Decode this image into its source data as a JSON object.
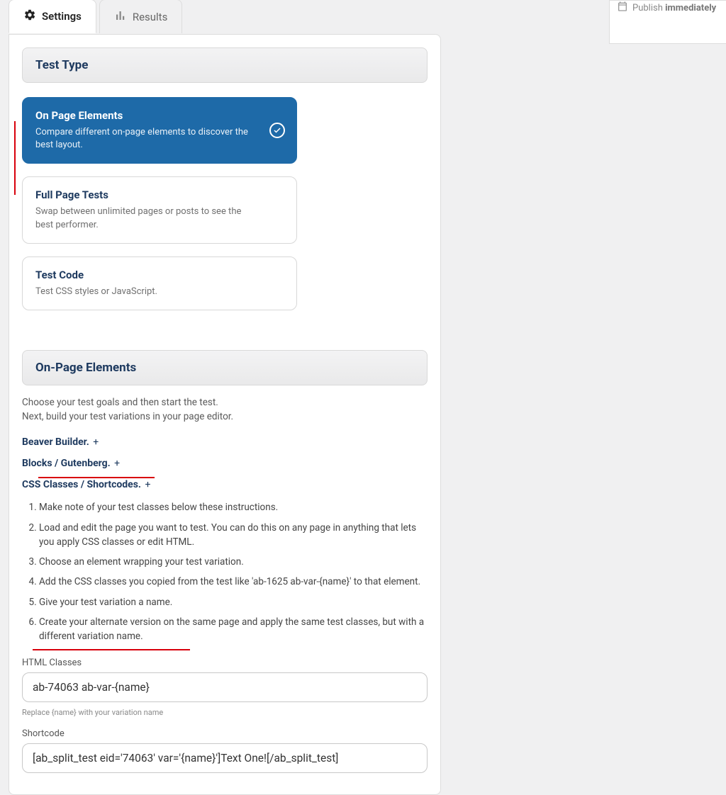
{
  "sidebar": {
    "publish_prefix": "Publish ",
    "publish_bold": "immediately"
  },
  "tabs": {
    "settings": "Settings",
    "results": "Results"
  },
  "sections": {
    "test_type_title": "Test Type",
    "on_page_elements_title": "On-Page Elements"
  },
  "types": [
    {
      "title": "On Page Elements",
      "desc": "Compare different on-page elements to discover the best layout."
    },
    {
      "title": "Full Page Tests",
      "desc": "Swap between unlimited pages or posts to see the best performer."
    },
    {
      "title": "Test Code",
      "desc": "Test CSS styles or JavaScript."
    }
  ],
  "intro": {
    "line1": "Choose your test goals and then start the test.",
    "line2": "Next, build your test variations in your page editor."
  },
  "builders": [
    "Beaver Builder.",
    "Blocks / Gutenberg.",
    "CSS Classes / Shortcodes."
  ],
  "plus": "+",
  "steps": [
    "Make note of your test classes below these instructions.",
    "Load and edit the page you want to test. You can do this on any page in anything that lets you apply CSS classes or edit HTML.",
    "Choose an element wrapping your test variation.",
    "Add the CSS classes you copied from the test like 'ab-1625 ab-var-{name}' to that element.",
    "Give your test variation a name.",
    "Create your alternate version on the same page and apply the same test classes, but with a different variation name."
  ],
  "fields": {
    "html_classes_label": "HTML Classes",
    "html_classes_value": "ab-74063 ab-var-{name}",
    "html_classes_hint": "Replace {name} with your variation name",
    "shortcode_label": "Shortcode",
    "shortcode_value": "[ab_split_test eid='74063' var='{name}']Text One![/ab_split_test]"
  }
}
